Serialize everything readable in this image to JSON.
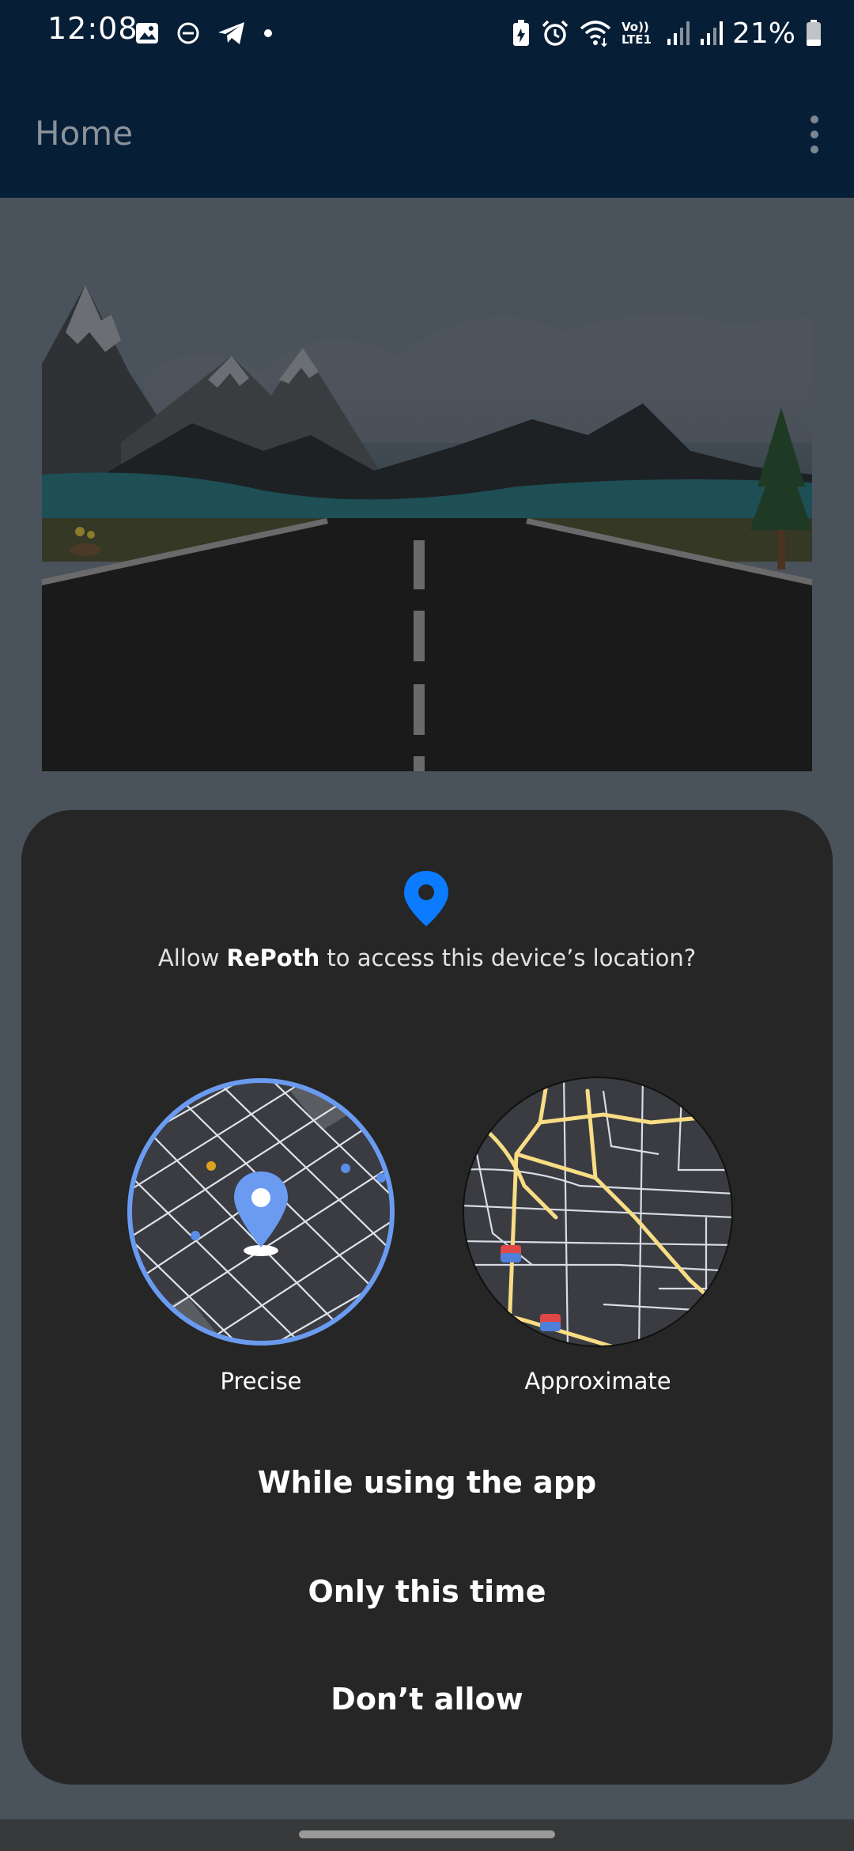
{
  "status_bar": {
    "time": "12:08",
    "network_label": "Vo)) LTE1",
    "battery": "21%",
    "icons": [
      "gallery-icon",
      "dnd-icon",
      "telegram-icon",
      "notification-dot-icon",
      "battery-saver-icon",
      "alarm-icon",
      "wifi-icon",
      "signal-icon",
      "signal-icon",
      "battery-icon"
    ]
  },
  "app_bar": {
    "title": "Home",
    "menu_icon": "more-vert-icon"
  },
  "hero": {
    "description_icon": "road-landscape-illustration"
  },
  "permission_dialog": {
    "icon": "location-pin-icon",
    "prompt_prefix": "Allow ",
    "app_name": "RePoth",
    "prompt_suffix": " to access this device’s location?",
    "options": [
      {
        "label": "Precise",
        "selected": true
      },
      {
        "label": "Approximate",
        "selected": false
      }
    ],
    "buttons": {
      "while_using": "While using the app",
      "only_this_time": "Only this time",
      "dont_allow": "Don’t allow"
    }
  },
  "colors": {
    "accent": "#0b7bff",
    "selected_ring": "#6a9bf0",
    "map_road_major": "#f8dd84",
    "dialog_bg": "#262626",
    "app_bar_bg": "#071e37"
  }
}
